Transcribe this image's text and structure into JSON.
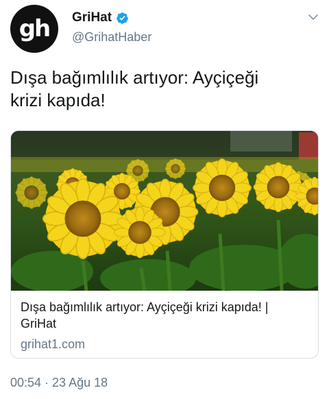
{
  "account": {
    "avatar_text": "gh",
    "display_name": "GriHat",
    "handle": "@GrihatHaber",
    "verified": true
  },
  "icons": {
    "verified": "verified-badge-icon",
    "menu": "chevron-down-icon"
  },
  "colors": {
    "verified_blue": "#1da1f2",
    "secondary_text": "#657786"
  },
  "tweet": {
    "text_line1": "Dışa bağımlılık artıyor: Ayçiçeği",
    "text_line2": "krizi kapıda!",
    "timestamp": "00:54 · 23 Ağu 18"
  },
  "card": {
    "title_line1": "Dışa bağımlılık artıyor: Ayçiçeği krizi kapıda! |",
    "title_line2": "GriHat",
    "domain": "grihat1.com"
  }
}
